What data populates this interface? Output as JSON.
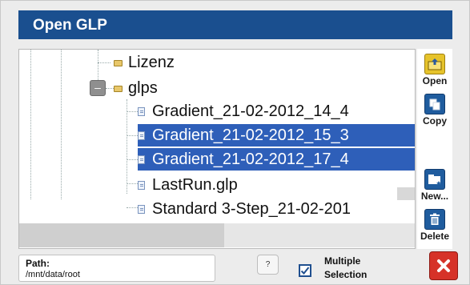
{
  "window": {
    "title": "Open GLP"
  },
  "tree": {
    "items": [
      {
        "label": "Lizenz",
        "type": "folder"
      },
      {
        "label": "glps",
        "type": "folder",
        "expanded": true
      },
      {
        "label": "Gradient_21-02-2012_14_4",
        "type": "file",
        "selected": false
      },
      {
        "label": "Gradient_21-02-2012_15_3",
        "type": "file",
        "selected": true
      },
      {
        "label": "Gradient_21-02-2012_17_4",
        "type": "file",
        "selected": true
      },
      {
        "label": "LastRun.glp",
        "type": "file",
        "selected": false
      },
      {
        "label": "Standard 3-Step_21-02-201",
        "type": "file",
        "selected": false
      }
    ],
    "collapse_symbol": "–"
  },
  "toolbar": {
    "open_label": "Open",
    "copy_label": "Copy",
    "new_label": "New...",
    "delete_label": "Delete"
  },
  "footer": {
    "path_label": "Path:",
    "path_value": "/mnt/data/root",
    "help_symbol": "?",
    "multiple_selection_line1": "Multiple",
    "multiple_selection_line2": "Selection",
    "multiple_selection_checked": true
  },
  "colors": {
    "title_bar": "#1a4f8f",
    "selection": "#2e5fb9",
    "close": "#d63228"
  }
}
